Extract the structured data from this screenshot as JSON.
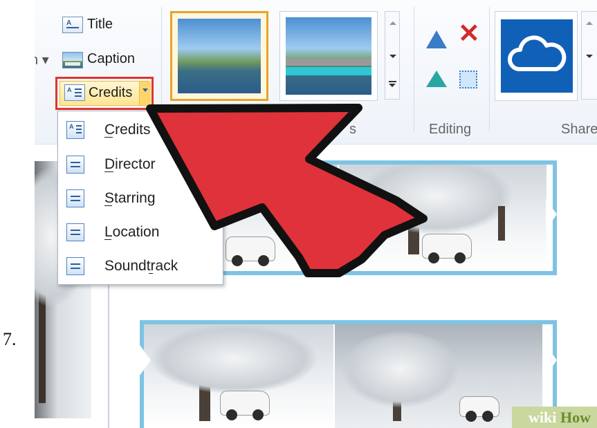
{
  "step_number": "7.",
  "ribbon": {
    "text_items": [
      {
        "label": "Title"
      },
      {
        "label": "Caption"
      },
      {
        "label": "Credits"
      }
    ],
    "themes_group_partial_label": "s",
    "editing_group_label": "Editing",
    "share_group_partial_label": "Share"
  },
  "credits_menu": {
    "items": [
      {
        "label": "Credits",
        "mnemonic": "C"
      },
      {
        "label": "Director",
        "mnemonic": "D"
      },
      {
        "label": "Starring",
        "mnemonic": "S"
      },
      {
        "label": "Location",
        "mnemonic": "L"
      },
      {
        "label": "Soundtrack",
        "mnemonic": "t"
      }
    ]
  },
  "watermark": {
    "wiki": "wiki",
    "how": "How"
  },
  "colors": {
    "highlight_box": "#e0352b",
    "arrow_fill": "#e0323a",
    "arrow_outline": "#111111",
    "clip_border": "#7ec3e4",
    "onedrive_tile": "#1060b8",
    "selected_theme": "#e6a428"
  }
}
